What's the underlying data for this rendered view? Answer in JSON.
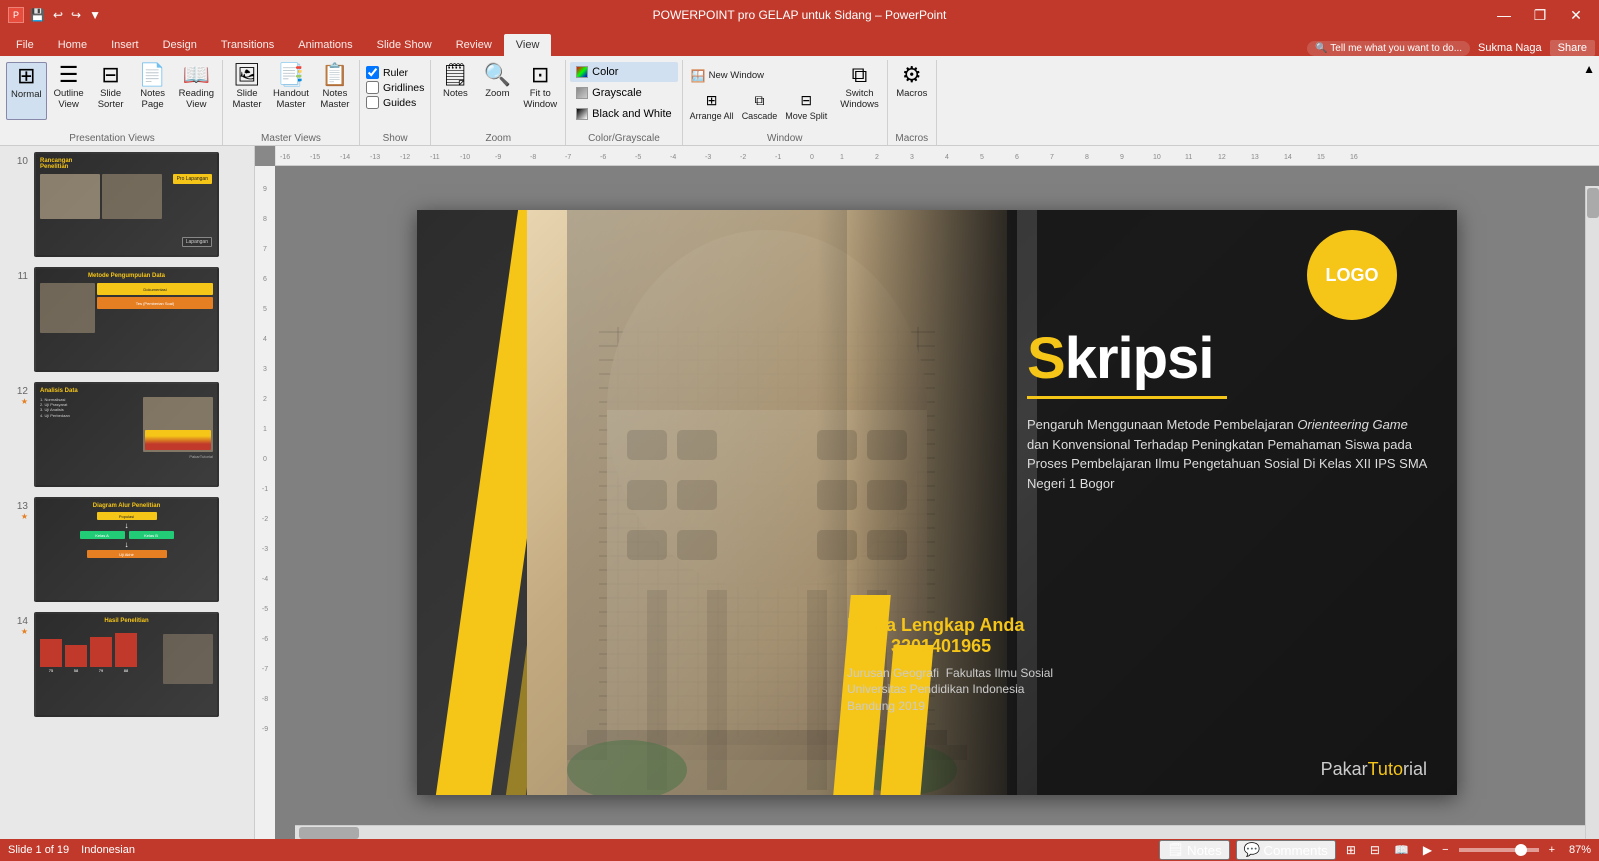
{
  "titlebar": {
    "title": "POWERPOINT pro GELAP untuk Sidang – PowerPoint",
    "minimize": "—",
    "maximize": "❐",
    "close": "✕"
  },
  "ribbon_tabs": {
    "tabs": [
      "File",
      "Home",
      "Insert",
      "Design",
      "Transitions",
      "Animations",
      "Slide Show",
      "Review",
      "View"
    ],
    "active": "View",
    "tell_me": "Tell me what you want to do...",
    "user": "Sukma Naga",
    "share": "Share"
  },
  "ribbon": {
    "groups": {
      "presentation_views": {
        "label": "Presentation Views",
        "buttons": [
          "Normal",
          "Outline View",
          "Slide Sorter",
          "Notes Page",
          "Reading View"
        ]
      },
      "master_views": {
        "label": "Master Views",
        "buttons": [
          "Slide Master",
          "Handout Master",
          "Notes Master"
        ]
      },
      "show": {
        "label": "Show",
        "checkboxes": [
          "Ruler",
          "Gridlines",
          "Guides"
        ]
      },
      "zoom": {
        "label": "Zoom",
        "buttons": [
          "Notes",
          "Zoom",
          "Fit to Window"
        ]
      },
      "color_grayscale": {
        "label": "Color/Grayscale",
        "options": [
          "Color",
          "Grayscale",
          "Black and White"
        ]
      },
      "window": {
        "label": "Window",
        "buttons": [
          "New Window",
          "Arrange All",
          "Cascade",
          "Move Split",
          "Switch Windows"
        ]
      },
      "macros": {
        "label": "Macros",
        "buttons": [
          "Macros"
        ]
      }
    }
  },
  "slide_panel": {
    "slides": [
      {
        "number": "10",
        "star": false,
        "label": "Rancangan Penelitian"
      },
      {
        "number": "11",
        "star": false,
        "label": "Metode Pengumpulan Data"
      },
      {
        "number": "12",
        "star": true,
        "label": "Analisis Data"
      },
      {
        "number": "13",
        "star": true,
        "label": "Diagram Alur Penelitian"
      },
      {
        "number": "14",
        "star": true,
        "label": "Hasil Penelitian"
      }
    ]
  },
  "slide": {
    "logo": "LOGO",
    "title_prefix": "S",
    "title_rest": "kripsi",
    "underline": true,
    "subtitle": "Pengaruh Menggunaan Metode Pembelajaran Orienteering Game dan Konvensional Terhadap Peningkatan Pemahaman Siswa pada Proses Pembelajaran Ilmu Pengetahuan Sosial Di Kelas XII IPS SMA Negeri 1 Bogor",
    "name": "Nama Lengkap Anda",
    "nim": "NIM: 3201401965",
    "institution": "Jurusan Geografi  Fakultas Ilmu Sosial\nUniversitas Pendidikan Indonesia\nBandung 2019",
    "watermark": "PakarTutorial"
  },
  "status": {
    "slide_info": "Slide 1 of 19",
    "language": "Indonesian",
    "notes_label": "Notes",
    "comments_label": "Comments",
    "zoom_percent": "87%"
  }
}
